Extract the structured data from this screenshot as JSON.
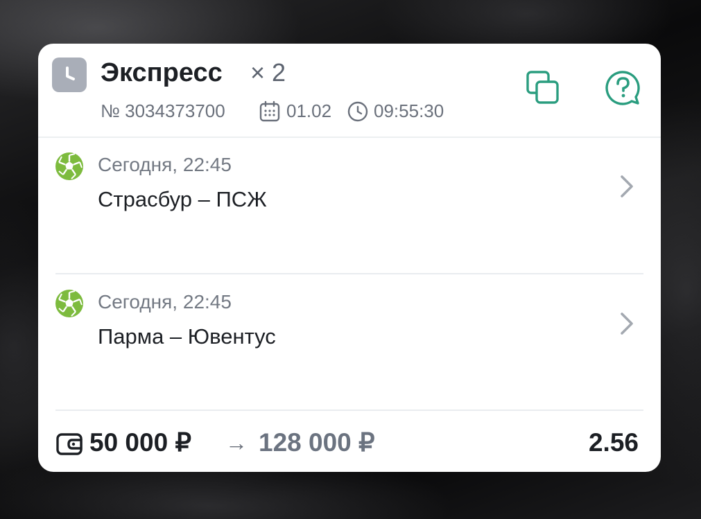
{
  "bet": {
    "type_icon": "clock-icon",
    "title": "Экспресс",
    "multiplier": "× 2",
    "number": "№ 3034373700",
    "date": "01.02",
    "time": "09:55:30",
    "copy_icon": "copy-icon",
    "help_icon": "help-icon"
  },
  "events": [
    {
      "sport_icon": "football-icon",
      "time": "Сегодня, 22:45",
      "name": "Страсбур – ПСЖ"
    },
    {
      "sport_icon": "football-icon",
      "time": "Сегодня, 22:45",
      "name": "Парма – Ювентус"
    }
  ],
  "footer": {
    "stake": "50 000 ₽",
    "arrow": "→",
    "payout": "128 000 ₽",
    "coefficient": "2.56"
  },
  "colors": {
    "accent": "#2a9d7f",
    "ball": "#7dbb3e",
    "badge": "#a9aeb8"
  }
}
